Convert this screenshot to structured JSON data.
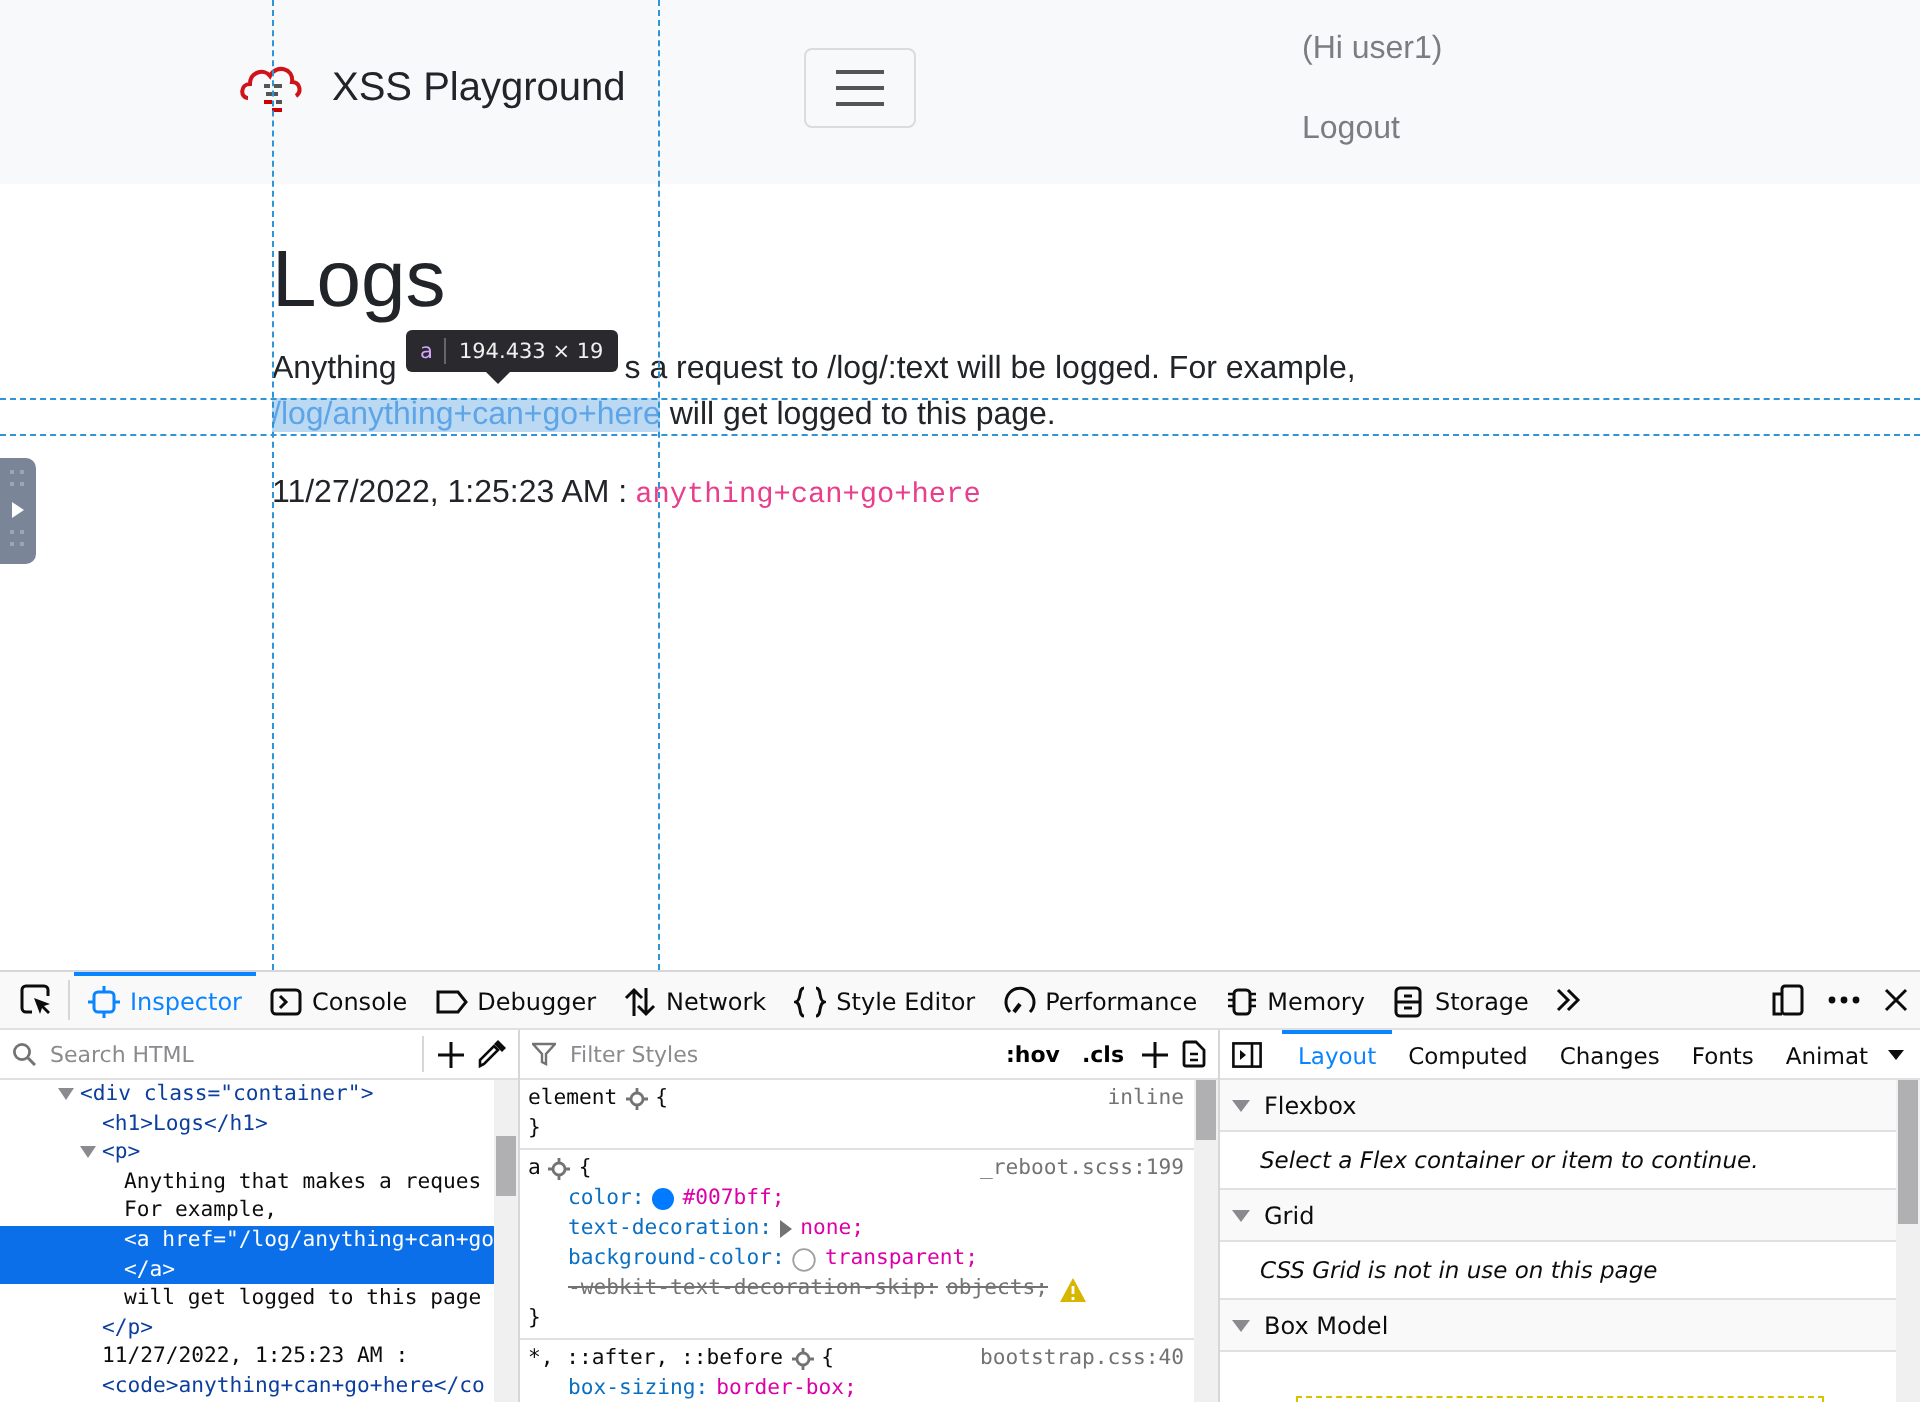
{
  "navbar": {
    "brand": "XSS Playground",
    "user_greeting": "(Hi user1)",
    "logout": "Logout"
  },
  "main": {
    "heading": "Logs",
    "intro_start": "Anything",
    "intro_rest": "s a request to /log/:text will be logged. For example,",
    "link": "/log/anything+can+go+here",
    "intro_end": "will get logged to this page.",
    "entries": [
      {
        "time": "11/27/2022, 1:25:23 AM :",
        "text": "anything+can+go+here"
      }
    ]
  },
  "highlighter": {
    "tag": "a",
    "size": "194.433 × 19"
  },
  "devtools": {
    "tools": [
      {
        "label": "Inspector",
        "selected": true
      },
      {
        "label": "Console",
        "selected": false
      },
      {
        "label": "Debugger",
        "selected": false
      },
      {
        "label": "Network",
        "selected": false
      },
      {
        "label": "Style Editor",
        "selected": false
      },
      {
        "label": "Performance",
        "selected": false
      },
      {
        "label": "Memory",
        "selected": false
      },
      {
        "label": "Storage",
        "selected": false
      }
    ],
    "search_placeholder": "Search HTML",
    "markup_tree": [
      {
        "lines": [
          "<div class=\"container\">"
        ],
        "kind": "tag",
        "selected": false,
        "expanded": true,
        "children": [
          {
            "lines": [
              "<h1>Logs</h1>"
            ],
            "kind": "tag",
            "selected": false
          },
          {
            "lines": [
              "<p>"
            ],
            "kind": "tag",
            "selected": false,
            "expanded": true,
            "children": [
              {
                "lines": [
                  "Anything that makes a reques",
                  "For example,"
                ],
                "kind": "text",
                "selected": false
              },
              {
                "lines": [
                  "<a href=\"/log/anything+can+go",
                  "</a>"
                ],
                "kind": "tag",
                "selected": true
              },
              {
                "lines": [
                  "will get logged to this page"
                ],
                "kind": "text",
                "selected": false
              }
            ]
          },
          {
            "lines": [
              "</p>"
            ],
            "kind": "tag",
            "selected": false
          },
          {
            "lines": [
              "11/27/2022, 1:25:23 AM :"
            ],
            "kind": "text",
            "selected": false
          },
          {
            "lines": [
              "<code>anything+can+go+here</co"
            ],
            "kind": "tag",
            "selected": false
          }
        ]
      }
    ],
    "filter_placeholder": "Filter Styles",
    "pseudo_toggle": ":hov",
    "class_toggle": ".cls",
    "rules": [
      {
        "selector": "element",
        "open": "{",
        "source": "inline",
        "close": "}"
      },
      {
        "selector": "a",
        "open": "{",
        "source": "_reboot.scss:199",
        "close": "}",
        "declarations": [
          {
            "property": "color:",
            "value": "#007bff;",
            "kind": "color",
            "color": "#007bff",
            "overridden": false
          },
          {
            "property": "text-decoration:",
            "value": "none;",
            "kind": "expandable",
            "overridden": false
          },
          {
            "property": "background-color:",
            "value": "transparent;",
            "kind": "transparent",
            "overridden": false
          },
          {
            "property": "-webkit-text-decoration-skip:",
            "value": "objects;",
            "kind": "plain",
            "overridden": true
          }
        ]
      },
      {
        "selector": "*, ::after, ::before",
        "open": "{",
        "source": "bootstrap.css:40",
        "declarations": [
          {
            "property": "box-sizing:",
            "value": "border-box;",
            "kind": "plain",
            "overridden": false
          }
        ]
      }
    ],
    "sidebar_tabs": [
      {
        "label": "Layout",
        "selected": true
      },
      {
        "label": "Computed",
        "selected": false
      },
      {
        "label": "Changes",
        "selected": false
      },
      {
        "label": "Fonts",
        "selected": false
      },
      {
        "label": "Animat",
        "selected": false
      }
    ],
    "sections": [
      {
        "title": "Flexbox",
        "expanded": true,
        "kind": "message",
        "message": "Select a Flex container or item to continue."
      },
      {
        "title": "Grid",
        "expanded": true,
        "kind": "message",
        "message": "CSS Grid is not in use on this page"
      },
      {
        "title": "Box Model",
        "expanded": true,
        "kind": "box-model"
      }
    ]
  }
}
